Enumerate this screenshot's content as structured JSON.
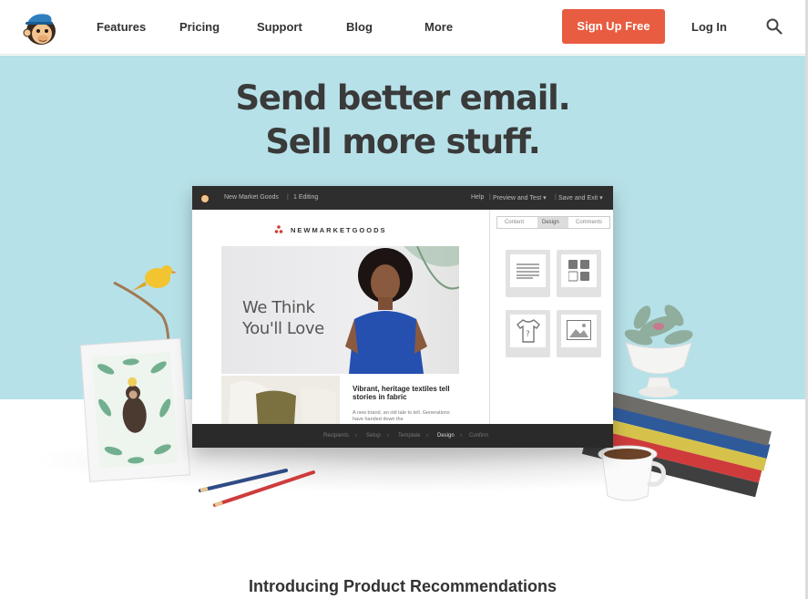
{
  "nav": {
    "links": [
      "Features",
      "Pricing",
      "Support",
      "Blog",
      "More"
    ],
    "signup_label": "Sign Up Free",
    "login_label": "Log In"
  },
  "colors": {
    "accent": "#e85c41",
    "hero_bg": "#b7e1e8"
  },
  "hero": {
    "line1": "Send better email.",
    "line2": "Sell more stuff."
  },
  "app": {
    "campaign_name": "New Market Goods",
    "editing": "1 Editing",
    "help": "Help",
    "preview": "Preview and Test ▾",
    "save": "Save and Exit ▾",
    "tabs": [
      "Content",
      "Design",
      "Comments"
    ],
    "steps": [
      "Recipients",
      "Setup",
      "Template",
      "Design",
      "Confirm"
    ],
    "email": {
      "brand": "NEWMARKETGOODS",
      "hero_line1": "We Think",
      "hero_line2": "You'll Love",
      "article_title": "Vibrant, heritage textiles tell stories in fabric",
      "article_body": "A new brand, an old tale to tell. Generations have handed down the"
    }
  },
  "section": {
    "title": "Introducing Product Recommendations"
  }
}
